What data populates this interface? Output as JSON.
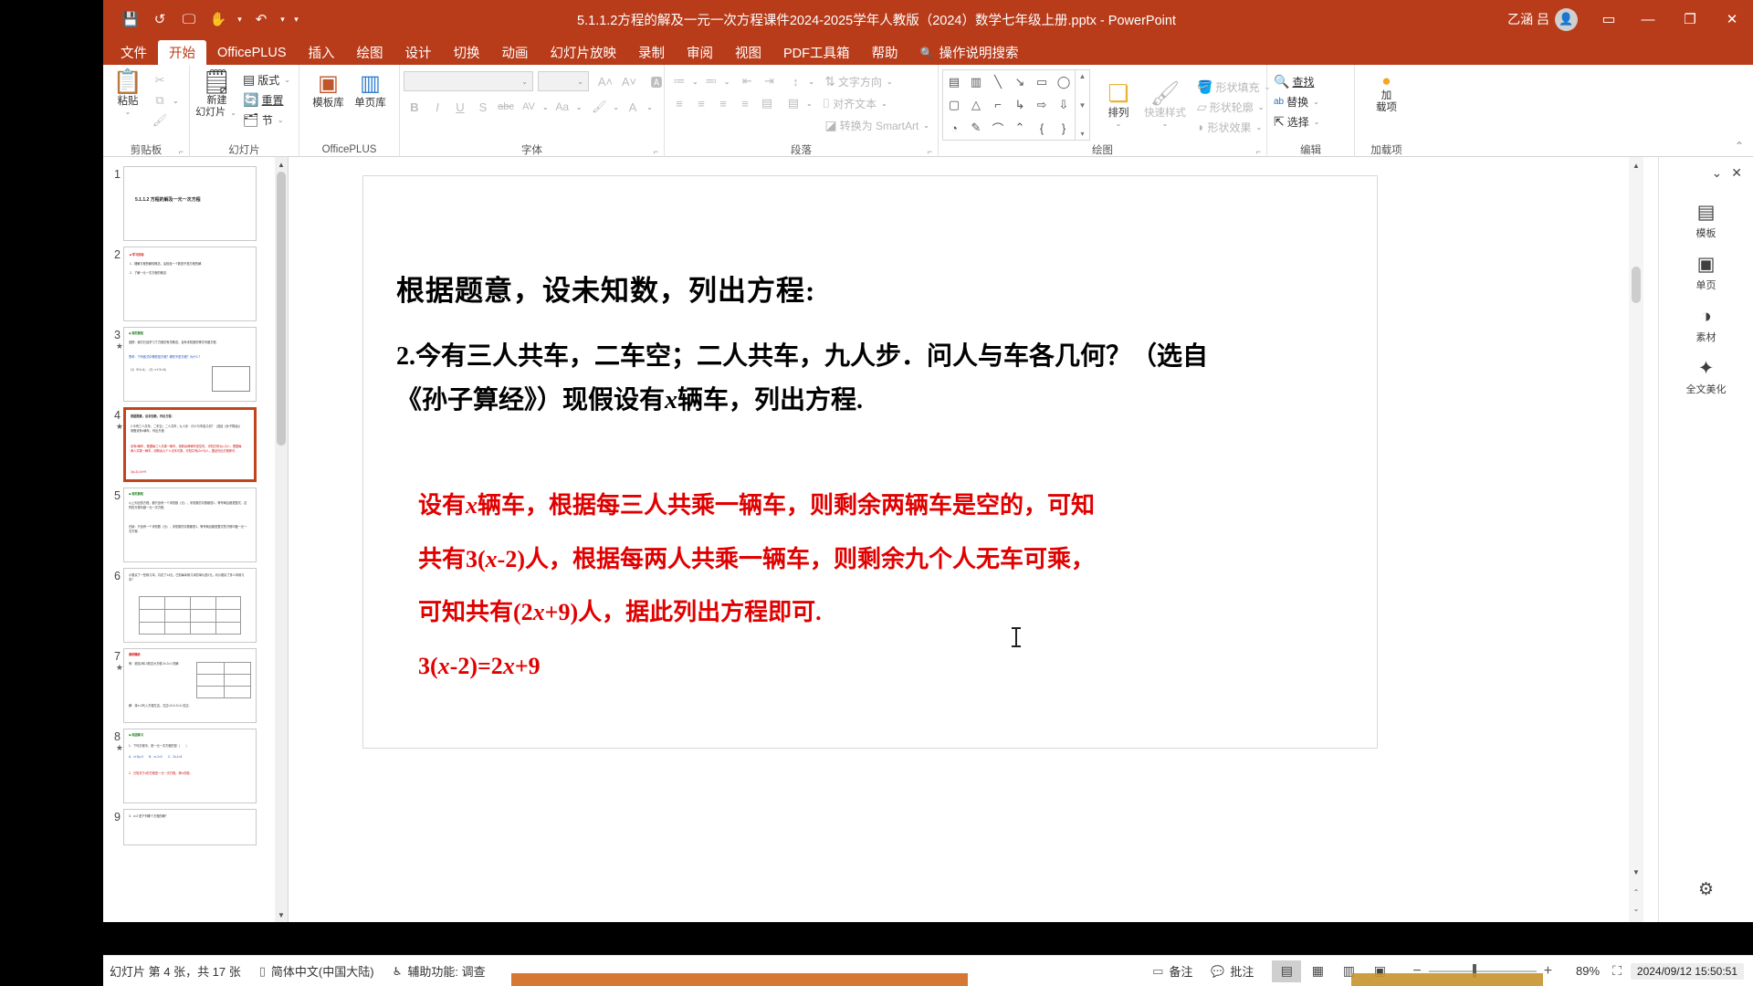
{
  "window": {
    "title": "5.1.1.2方程的解及一元一次方程课件2024-2025学年人教版（2024）数学七年级上册.pptx  -  PowerPoint",
    "user_name": "乙涵 吕",
    "avatar_glyph": "👤",
    "minimize": "—",
    "restore": "❐",
    "close": "✕",
    "ribbon_display": "▭"
  },
  "quick_access": {
    "save": "💾",
    "undo_circle": "↺",
    "present": "🖵",
    "pointer": "✋",
    "undo": "↶",
    "more": "▾"
  },
  "tabs": [
    {
      "label": "文件",
      "active": false
    },
    {
      "label": "开始",
      "active": true
    },
    {
      "label": "OfficePLUS",
      "active": false
    },
    {
      "label": "插入",
      "active": false
    },
    {
      "label": "绘图",
      "active": false
    },
    {
      "label": "设计",
      "active": false
    },
    {
      "label": "切换",
      "active": false
    },
    {
      "label": "动画",
      "active": false
    },
    {
      "label": "幻灯片放映",
      "active": false
    },
    {
      "label": "录制",
      "active": false
    },
    {
      "label": "审阅",
      "active": false
    },
    {
      "label": "视图",
      "active": false
    },
    {
      "label": "PDF工具箱",
      "active": false
    },
    {
      "label": "帮助",
      "active": false
    }
  ],
  "tell_me": {
    "icon": "🔍",
    "label": "操作说明搜索"
  },
  "ribbon": {
    "groups": [
      {
        "label": "剪贴板",
        "has_launcher": true,
        "paste": {
          "label": "粘贴",
          "caret": "⌄"
        },
        "cut": "✂",
        "copy": "⧉",
        "format_painter": "🖌"
      },
      {
        "label": "幻灯片",
        "has_launcher": false,
        "new_slide": {
          "label": "新建\n幻灯片",
          "caret": "⌄"
        },
        "layout": {
          "label": "版式",
          "caret": "⌄"
        },
        "reset": {
          "label": "重置"
        },
        "section": {
          "label": "节",
          "caret": "⌄"
        }
      },
      {
        "label": "OfficePLUS",
        "has_launcher": false,
        "template_lib": "模板库",
        "page_lib": "单页库"
      },
      {
        "label": "字体",
        "has_launcher": true,
        "font_name_value": "",
        "font_size_value": "",
        "grow": "A",
        "shrink": "A",
        "clear_format": "A̶",
        "bold": "B",
        "italic": "I",
        "underline": "U",
        "shadow": "S",
        "strike": "abc",
        "char_spacing": "AV",
        "change_case": "Aa",
        "highlight": "ab",
        "font_color": "A"
      },
      {
        "label": "段落",
        "has_launcher": true,
        "bullets": "≔",
        "numbering": "≕",
        "decrease_indent": "⇤",
        "increase_indent": "⇥",
        "line_spacing": "↕",
        "align_left": "≡",
        "align_center": "≡",
        "align_right": "≡",
        "justify": "≡",
        "columns": "▤",
        "text_direction": {
          "label": "文字方向",
          "caret": "⌄"
        },
        "align_text": {
          "label": "对齐文本",
          "caret": "⌄"
        },
        "smartart": {
          "label": "转换为 SmartArt",
          "caret": "⌄"
        }
      },
      {
        "label": "绘图",
        "has_launcher": true,
        "shapes": [
          "▤",
          "▥",
          "╲",
          "╲",
          "▭",
          "◯",
          "▢",
          "△",
          "⌐",
          "↳",
          "⇨",
          "⇩",
          "◔",
          "✎",
          "⌒",
          "⌃",
          "{",
          "}"
        ],
        "arrange": {
          "label": "排列",
          "caret": "⌄"
        },
        "quick_styles": {
          "label": "快速样式",
          "caret": "⌄"
        },
        "shape_fill": {
          "label": "形状填充",
          "caret": "⌄"
        },
        "shape_outline": {
          "label": "形状轮廓",
          "caret": "⌄"
        },
        "shape_effects": {
          "label": "形状效果",
          "caret": "⌄"
        }
      },
      {
        "label": "编辑",
        "has_launcher": false,
        "find": {
          "icon": "🔍",
          "label": "查找"
        },
        "replace": {
          "icon": "ab",
          "label": "替换",
          "caret": "⌄"
        },
        "select": {
          "icon": "⇱",
          "label": "选择",
          "caret": "⌄"
        }
      },
      {
        "label": "加载项",
        "has_launcher": false,
        "addin": {
          "label": "加\n载项",
          "glyph": "●"
        }
      }
    ],
    "collapse_caret": "⌃"
  },
  "thumbnails": {
    "items": [
      {
        "num": "1",
        "starred": false,
        "selected": false,
        "title": "5.1.1.2  方程的解及一元一次方程",
        "kind": "title"
      },
      {
        "num": "2",
        "starred": false,
        "selected": false,
        "kind": "text"
      },
      {
        "num": "3",
        "starred": true,
        "selected": false,
        "kind": "mixed"
      },
      {
        "num": "4",
        "starred": true,
        "selected": true,
        "kind": "mixed"
      },
      {
        "num": "5",
        "starred": false,
        "selected": false,
        "kind": "text"
      },
      {
        "num": "6",
        "starred": false,
        "selected": false,
        "kind": "table"
      },
      {
        "num": "7",
        "starred": true,
        "selected": false,
        "kind": "table"
      },
      {
        "num": "8",
        "starred": true,
        "selected": false,
        "kind": "text"
      },
      {
        "num": "9",
        "starred": false,
        "selected": false,
        "kind": "text"
      }
    ],
    "scroll_up": "▲",
    "scroll_down": "▼"
  },
  "slide": {
    "heading": "根据题意，设未知数，列出方程:",
    "question_line1_pre": "2.今有三人共车，二车空；二人共车，九人步．问人与车各几何？（选自",
    "question_line2_a": "《孙子算经》）现假设有",
    "question_line2_x": "x",
    "question_line2_b": "辆车，列出方程.",
    "answer_lines": [
      {
        "parts": [
          {
            "t": "设有",
            "i": false
          },
          {
            "t": "x",
            "i": true
          },
          {
            "t": "辆车，根据每三人共乘一辆车，则剩余两辆车是空的，可知",
            "i": false
          }
        ]
      },
      {
        "parts": [
          {
            "t": "共有3(",
            "i": false
          },
          {
            "t": "x",
            "i": true
          },
          {
            "t": "-2)人，根据每两人共乘一辆车，则剩余九个人无车可乘，",
            "i": false
          }
        ]
      },
      {
        "parts": [
          {
            "t": "可知共有(2",
            "i": false
          },
          {
            "t": "x",
            "i": true
          },
          {
            "t": "+9)人，据此列出方程即可.",
            "i": false
          }
        ]
      },
      {
        "parts": [
          {
            "t": "3(",
            "i": false
          },
          {
            "t": "x",
            "i": true
          },
          {
            "t": "-2)=2",
            "i": false
          },
          {
            "t": "x",
            "i": true
          },
          {
            "t": "+9",
            "i": false
          }
        ]
      }
    ]
  },
  "right_panel": {
    "collapse": "⌄",
    "close": "✕",
    "items": [
      {
        "glyph": "▤",
        "label": "模板"
      },
      {
        "glyph": "▣",
        "label": "单页"
      },
      {
        "glyph": "◑",
        "label": "素材"
      },
      {
        "glyph": "✦",
        "label": "全文美化"
      }
    ],
    "settings_glyph": "⚙"
  },
  "status_bar": {
    "slide_counter": "幻灯片 第 4 张，共 17 张",
    "book_icon": "▯",
    "language": "简体中文(中国大陆)",
    "accessibility_icon": "♿",
    "accessibility": "辅助功能: 调查",
    "notes_icon": "▭",
    "notes": "备注",
    "comments_icon": "💬",
    "comments": "批注",
    "view_normal": "▤",
    "view_sorter": "▦",
    "view_reading": "▥",
    "view_show": "▣",
    "fit_icon": "⛶",
    "zoom_out": "−",
    "zoom_in": "+",
    "zoom_level": "89%",
    "clock": "2024/09/12 15:50:51"
  }
}
